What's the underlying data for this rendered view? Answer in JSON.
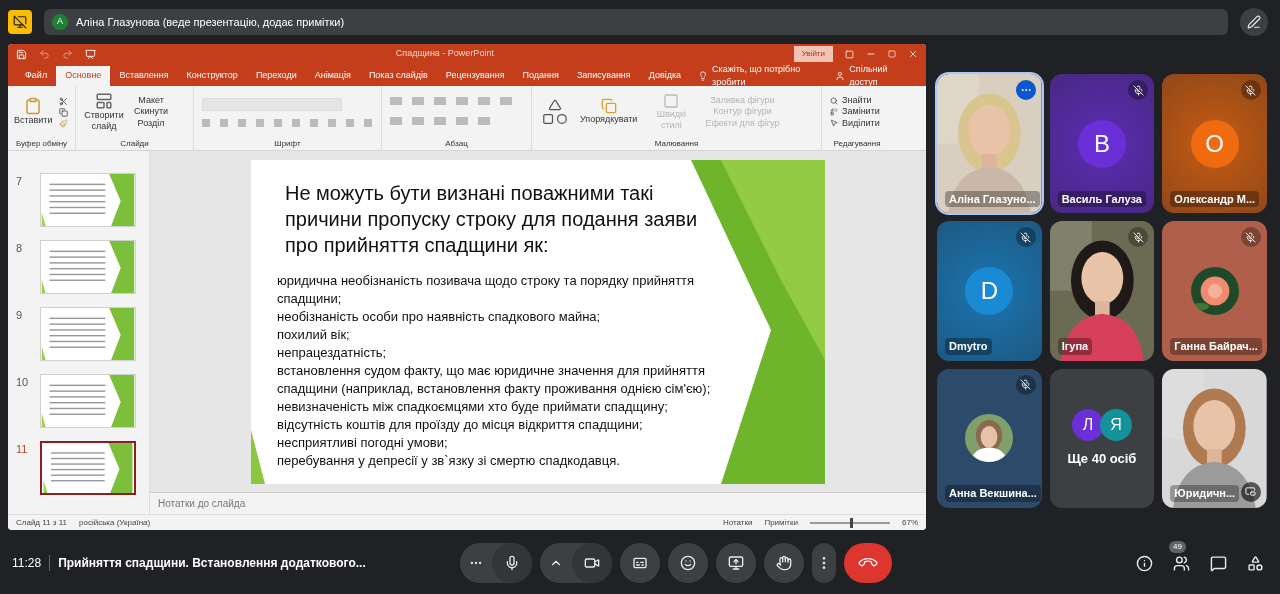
{
  "top_bar": {
    "presenter_initial": "A",
    "presenter_text": "Аліна Глазунова (веде презентацію, додає примітки)"
  },
  "powerpoint": {
    "title": "Спадщина - PowerPoint",
    "signin": "Увійти",
    "tabs": [
      {
        "label": "Файл",
        "selected": false
      },
      {
        "label": "Основне",
        "selected": true
      },
      {
        "label": "Вставлення",
        "selected": false
      },
      {
        "label": "Конструктор",
        "selected": false
      },
      {
        "label": "Переходи",
        "selected": false
      },
      {
        "label": "Анімація",
        "selected": false
      },
      {
        "label": "Показ слайдів",
        "selected": false
      },
      {
        "label": "Рецензування",
        "selected": false
      },
      {
        "label": "Подання",
        "selected": false
      },
      {
        "label": "Записування",
        "selected": false
      },
      {
        "label": "Довідка",
        "selected": false
      }
    ],
    "tell_me": "Скажіть, що потрібно зробити",
    "share": "Спільний доступ",
    "groups": [
      {
        "label": "Буфер обміну",
        "items": [
          {
            "label": "Вставити",
            "disabled": false
          }
        ]
      },
      {
        "label": "Слайди",
        "items": [
          {
            "label": "Створити слайд",
            "disabled": false
          },
          {
            "label": "Макет",
            "disabled": false
          },
          {
            "label": "Скинути",
            "disabled": false
          },
          {
            "label": "Розділ",
            "disabled": false
          }
        ]
      },
      {
        "label": "Шрифт"
      },
      {
        "label": "Абзац"
      },
      {
        "label": "Малювання",
        "items": [
          {
            "label": "Упорядкувати",
            "disabled": false
          },
          {
            "label": "Швидкі стилі",
            "disabled": true
          },
          {
            "label": "Заливка фігури",
            "disabled": true
          },
          {
            "label": "Контур фігури",
            "disabled": true
          },
          {
            "label": "Ефекти для фігур",
            "disabled": true
          }
        ]
      },
      {
        "label": "Редагування",
        "items": [
          {
            "label": "Знайти",
            "disabled": false
          },
          {
            "label": "Замінити",
            "disabled": false
          },
          {
            "label": "Виділити",
            "disabled": false
          }
        ]
      }
    ],
    "thumbnails": [
      {
        "number": "7",
        "selected": false
      },
      {
        "number": "8",
        "selected": false
      },
      {
        "number": "9",
        "selected": false
      },
      {
        "number": "10",
        "selected": false
      },
      {
        "number": "11",
        "selected": true
      }
    ],
    "slide": {
      "title": "Не можуть бути визнані поважними такі причини пропуску строку для подання заяви про прийняття спадщини як:",
      "lines": [
        "юридична необізнаність позивача щодо строку та порядку прийняття спадщини;",
        "необізнаність особи про наявність спадкового майна;",
        "похилий вік;",
        "непрацездатність;",
        "встановлення судом факту, що має юридичне значення для прийняття спадщини (наприклад, встановлення факту проживання однією сім'єю);",
        "невизначеність між спадкоємцями хто буде приймати спадщину;",
        "відсутність коштів для проїзду до місця відкриття спадщини;",
        "несприятливі погодні умови;",
        "перебування у депресії у зв`язку зі смертю спадкодавця."
      ]
    },
    "notes_placeholder": "Нотатки до слайда",
    "status": {
      "slide_count": "Слайд 11 з 11",
      "language": "російська (Україна)",
      "notes": "Нотатки",
      "comments": "Примітки",
      "zoom": "67%",
      "zoom_level": {
        "level": 0.5
      }
    }
  },
  "participants": [
    {
      "name": "Аліна Глазуно...",
      "kind": "video",
      "muted": false,
      "speaking": true
    },
    {
      "name": "Василь Галуза",
      "kind": "avatar",
      "initial": "B",
      "color": "#6a2fd6",
      "muted": true,
      "speaking": false
    },
    {
      "name": "Олександр М...",
      "kind": "avatar",
      "initial": "O",
      "color": "#f06a0f",
      "muted": true,
      "speaking": false
    },
    {
      "name": "Dmytro",
      "kind": "avatar",
      "initial": "D",
      "color": "#1a8ad4",
      "muted": true,
      "speaking": false
    },
    {
      "name": "Iгупа",
      "kind": "video",
      "muted": true,
      "speaking": false
    },
    {
      "name": "Ганна Байрач...",
      "muted": true,
      "speaking": false
    },
    {
      "name": "Анна Векшина...",
      "muted": true,
      "speaking": false
    },
    {
      "kind": "more",
      "text": "Ще 40 осіб",
      "avatars": [
        {
          "initial": "Л",
          "color": "#6a2fd6"
        },
        {
          "initial": "Я",
          "color": "#12939a"
        }
      ]
    },
    {
      "name": "Юридичн...",
      "kind": "video",
      "muted": false,
      "speaking": false
    }
  ],
  "bottom_bar": {
    "time": "11:28",
    "meeting_title": "Прийняття спадщини. Встановлення додаткового...",
    "people_count": "49"
  }
}
